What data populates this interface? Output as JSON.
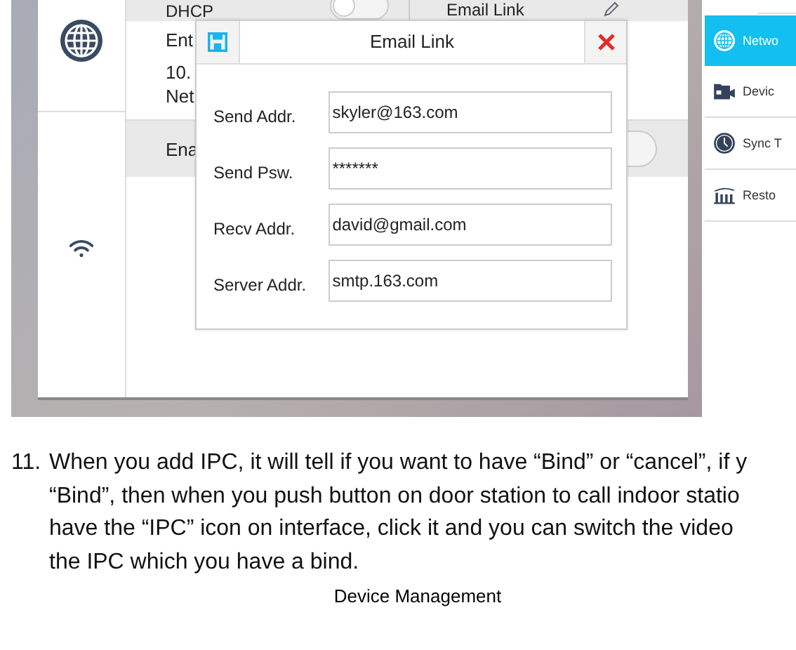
{
  "screenshot": {
    "sidebar_icons": [
      {
        "kind": "globe"
      },
      {
        "kind": "wifi"
      }
    ],
    "top_row": {
      "label": "DHCP",
      "on": false,
      "link": "Email Link"
    },
    "rows": [
      {
        "kind": "text",
        "label": "Ent"
      },
      {
        "kind": "text",
        "label": "10."
      },
      {
        "kind": "text",
        "label": "Net"
      },
      {
        "kind": "toggle",
        "label": "Ena",
        "on": false
      }
    ],
    "dialog": {
      "title": "Email Link",
      "fields": [
        {
          "label": "Send Addr.",
          "value": "skyler@163.com"
        },
        {
          "label": "Send Psw.",
          "value": "*******"
        },
        {
          "label": "Recv Addr.",
          "value": "david@gmail.com"
        },
        {
          "label": "Server Addr.",
          "value": "smtp.163.com"
        }
      ]
    }
  },
  "side_menu": {
    "items": [
      {
        "label": "Netwo",
        "kind": "globe",
        "selected": true
      },
      {
        "label": "Devic",
        "kind": "camera",
        "selected": false
      },
      {
        "label": "Sync T",
        "kind": "clock",
        "selected": false
      },
      {
        "label": "Resto",
        "kind": "factory",
        "selected": false
      }
    ]
  },
  "paragraph": {
    "number": "11.",
    "lines": [
      "When you add IPC, it will tell if you want to have “Bind” or “cancel”, if y",
      "“Bind”, then when you push button on door station to call indoor statio",
      "have the “IPC” icon on interface, click it and you can switch the video",
      "the IPC which you have a bind."
    ]
  },
  "caption": "Device Management"
}
